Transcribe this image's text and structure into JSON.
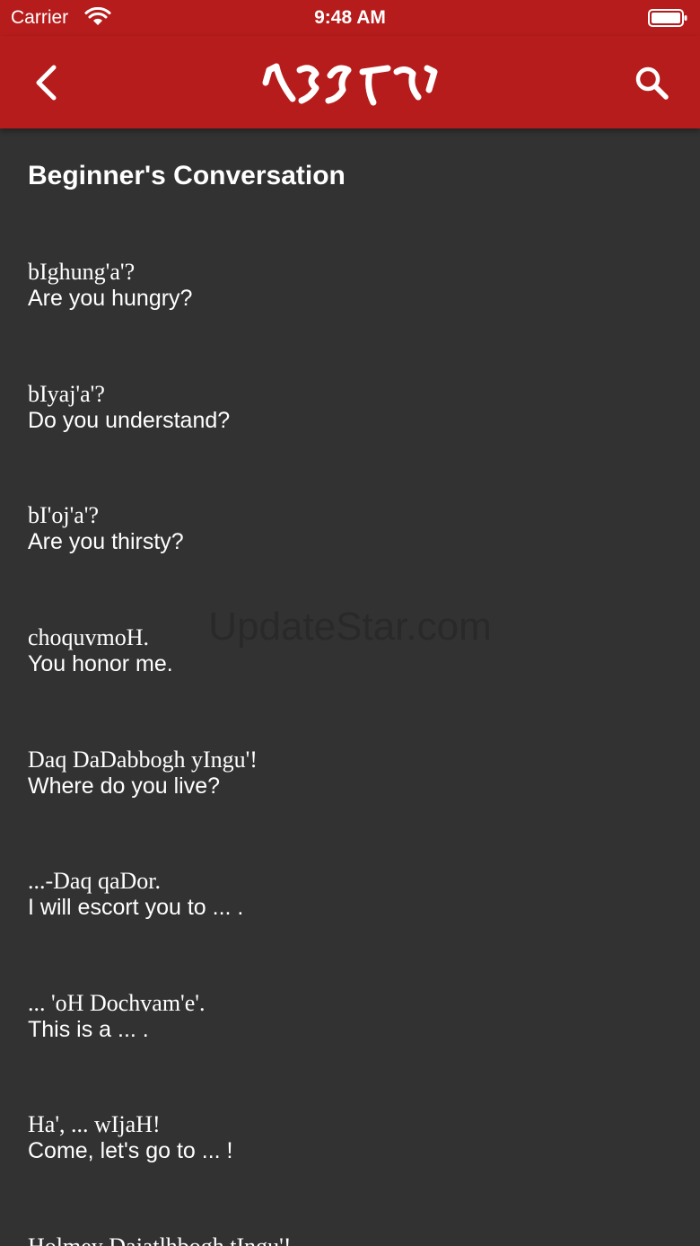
{
  "status_bar": {
    "carrier": "Carrier",
    "time": "9:48 AM",
    "icons": [
      "wifi-icon",
      "battery-icon"
    ]
  },
  "nav_bar": {
    "background_color": "#b71c1c",
    "back_icon": "chevron-left-icon",
    "search_icon": "search-icon",
    "title_icon": "klingon-script-logo"
  },
  "section": {
    "title": "Beginner's Conversation"
  },
  "phrases": [
    {
      "klingon": "bIghung'a'?",
      "english": "Are you hungry?"
    },
    {
      "klingon": "bIyaj'a'?",
      "english": "Do you understand?"
    },
    {
      "klingon": "bI'oj'a'?",
      "english": "Are you thirsty?"
    },
    {
      "klingon": "choquvmoH.",
      "english": "You honor me."
    },
    {
      "klingon": "Daq DaDabbogh yIngu'!",
      "english": "Where do you live?"
    },
    {
      "klingon": "...-Daq qaDor.",
      "english": "I will escort you to ... ."
    },
    {
      "klingon": "... 'oH Dochvam'e'.",
      "english": "This is a ... ."
    },
    {
      "klingon": "Ha', ... wIjaH!",
      "english": "Come, let's go to ... !"
    },
    {
      "klingon": "Holmey Dajatlhbogh tIngu'!",
      "english": ""
    }
  ],
  "watermark": "UpdateStar.com",
  "colors": {
    "header": "#b71c1c",
    "background": "#323232",
    "text": "#ffffff"
  }
}
